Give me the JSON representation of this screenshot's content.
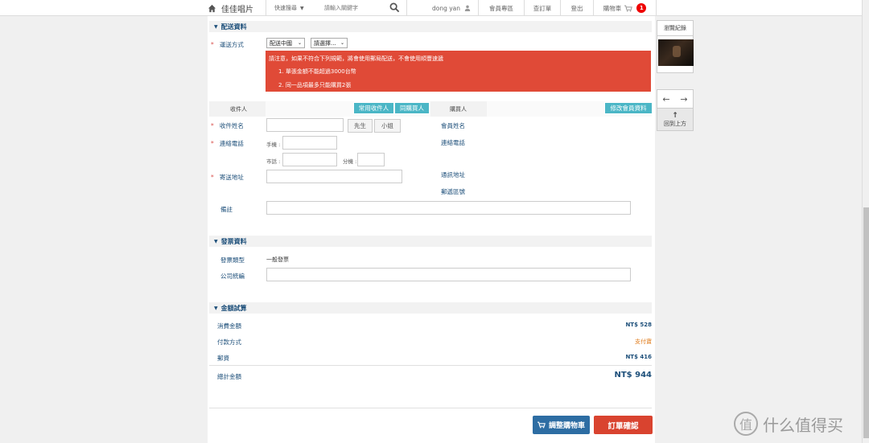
{
  "topbar": {
    "site_name": "佳佳唱片",
    "search_type": "快速搜尋",
    "search_placeholder": "請輸入關鍵字",
    "user_name": "dong yan",
    "member_zone": "會員專區",
    "order_lookup": "查訂單",
    "logout": "登出",
    "cart": "購物車",
    "cart_count": "1"
  },
  "shipping": {
    "section_title": "配送資料",
    "method_label": "運送方式",
    "method_value": "配送中國",
    "method_select2": "請選擇...",
    "notice_line1": "請注意，如果不符合下列規範，將會使用郵局配送，不會使用順豐速遞",
    "notice_line2": "1. 單張金額不能超過3000台幣",
    "notice_line3": "2. 同一品項最多只能購買2張"
  },
  "recipient": {
    "header": "收件人",
    "btn_common": "常用收件人",
    "btn_same": "同購買人",
    "name_label": "收件姓名",
    "mr": "先生",
    "ms": "小姐",
    "phone_label": "連絡電話",
    "mobile": "手機 :",
    "landline": "市話 :",
    "ext": "分機 :",
    "address_label": "寄送地址",
    "note_label": "備註"
  },
  "buyer": {
    "header": "購買人",
    "btn_edit": "修改會員資料",
    "name_label": "會員姓名",
    "phone_label": "連絡電話",
    "address_label": "通訊地址",
    "zip_label": "郵遞區號"
  },
  "invoice": {
    "section_title": "發票資料",
    "type_label": "發票類型",
    "type_value": "一般發票",
    "tax_id_label": "公司統編"
  },
  "amount": {
    "section_title": "金額試算",
    "consume_label": "消費金額",
    "consume_value": "NT$ 528",
    "payment_label": "付款方式",
    "payment_value": "支付寶",
    "shipping_label": "郵資",
    "shipping_value": "NT$ 416",
    "total_label": "總計金額",
    "total_value": "NT$ 944"
  },
  "actions": {
    "adjust_cart": "調整購物車",
    "confirm": "訂單確認"
  },
  "sidebar": {
    "history": "瀏覽紀錄",
    "back_to_top": "回到上方"
  },
  "watermark": "什么值得买",
  "colors": {
    "teal": "#4bb6c6",
    "alert_red": "#e04a37",
    "confirm_red": "#d9432f",
    "blue": "#2d6da3",
    "label_blue": "#1d4f7a"
  }
}
